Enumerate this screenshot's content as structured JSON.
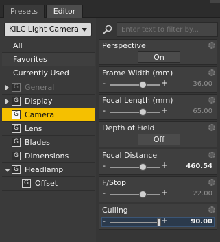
{
  "tabs": [
    {
      "label": "Presets"
    },
    {
      "label": "Editor"
    }
  ],
  "node_dropdown": {
    "value": "KILC Light Camera"
  },
  "categories": [
    {
      "label": "All"
    },
    {
      "label": "Favorites"
    },
    {
      "label": "Currently Used"
    }
  ],
  "tree": [
    {
      "label": "General",
      "icon": "G"
    },
    {
      "label": "Display",
      "icon": "G"
    },
    {
      "label": "Camera",
      "icon": "G"
    },
    {
      "label": "Lens",
      "icon": "G"
    },
    {
      "label": "Blades",
      "icon": "G"
    },
    {
      "label": "Dimensions",
      "icon": "G"
    },
    {
      "label": "Headlamp",
      "icon": "G"
    },
    {
      "label": "Offset",
      "icon": "G"
    }
  ],
  "filter": {
    "placeholder": "Enter text to filter by..."
  },
  "properties": {
    "perspective": {
      "title": "Perspective",
      "button": "On"
    },
    "frame_width": {
      "title": "Frame Width (mm)",
      "value": "36.00",
      "level": 0.66
    },
    "focal_length": {
      "title": "Focal Length (mm)",
      "value": "65.00",
      "level": 0.66
    },
    "depth_of_field": {
      "title": "Depth of Field",
      "button": "Off"
    },
    "focal_distance": {
      "title": "Focal Distance",
      "value": "460.54",
      "level": 0.66
    },
    "fstop": {
      "title": "F/Stop",
      "value": "22.00",
      "level": 0.66
    },
    "culling": {
      "title": "Culling",
      "value": "90.00",
      "level": 0.97
    }
  },
  "colors": {
    "selection": "#f5c000"
  }
}
